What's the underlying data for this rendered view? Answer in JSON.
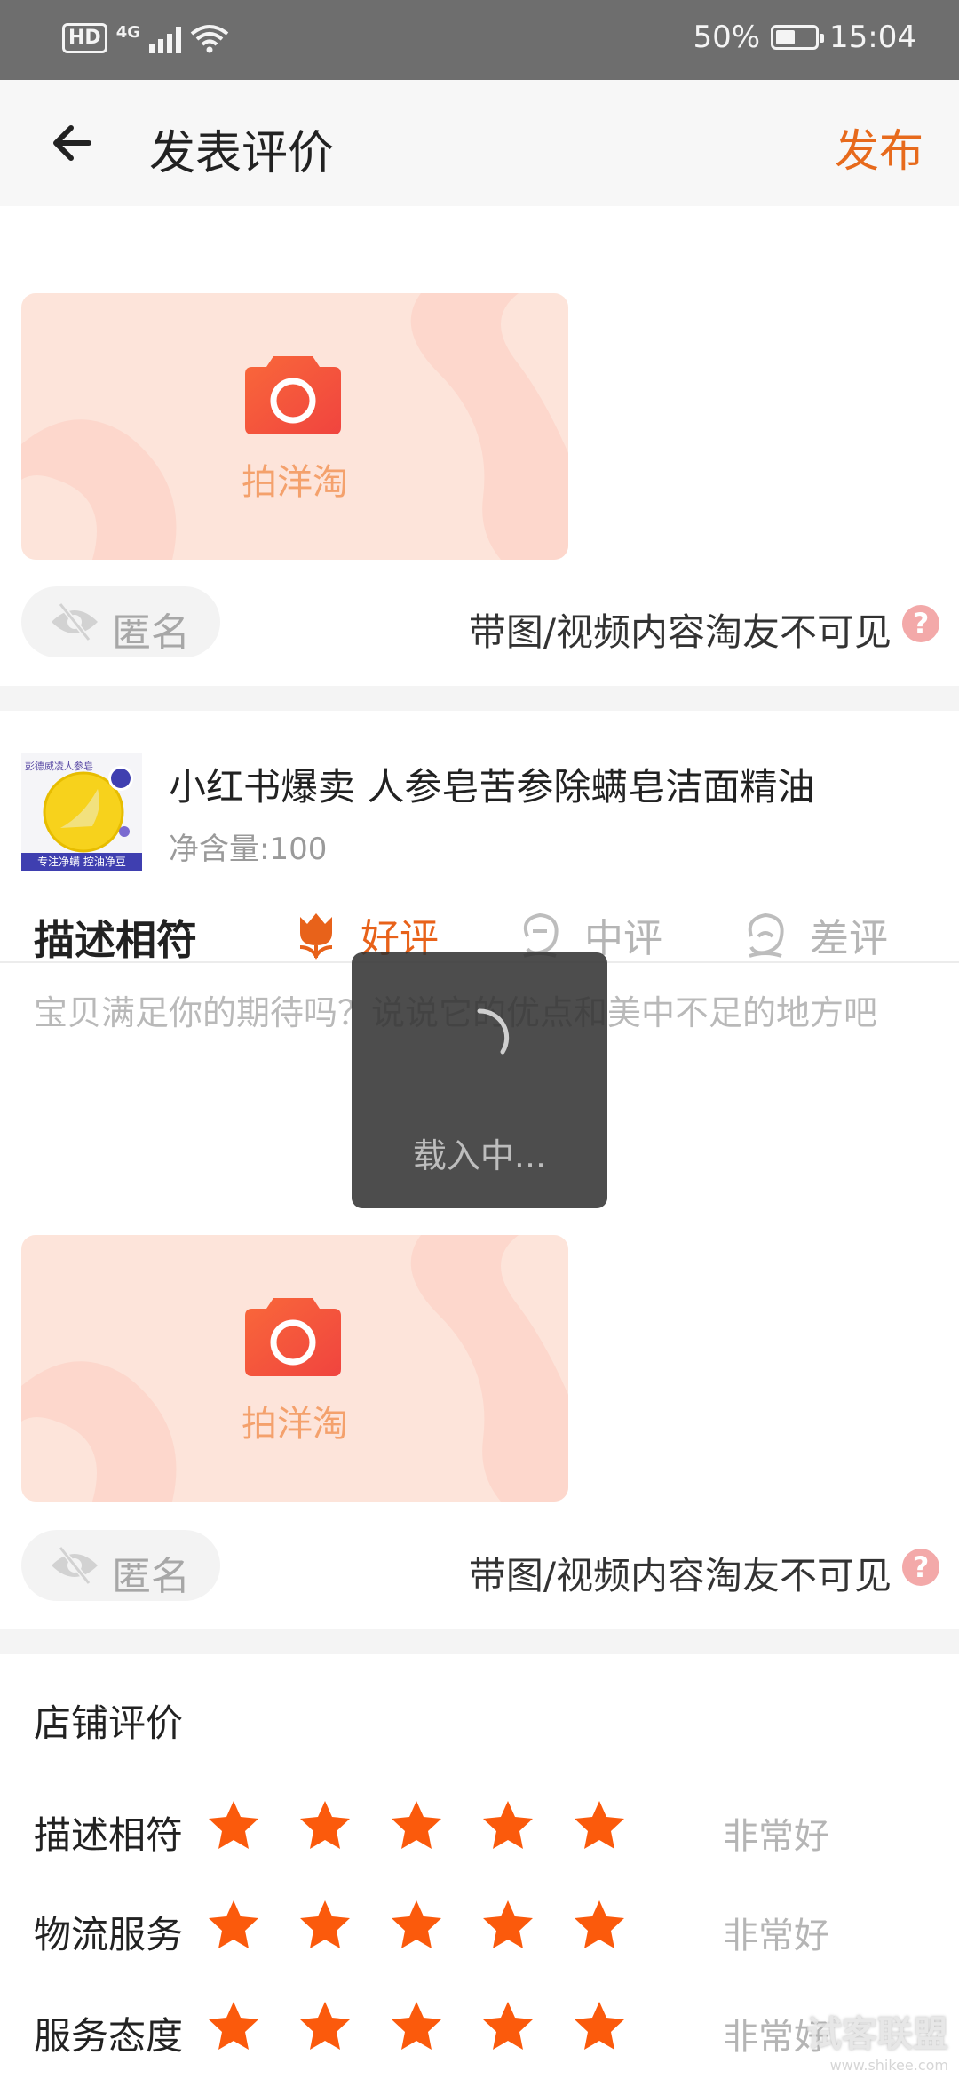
{
  "status_bar": {
    "hd": "HD",
    "network": "4G",
    "battery_percent": "50%",
    "battery_level": 0.5,
    "time": "15:04"
  },
  "header": {
    "back_icon": "arrow-left-icon",
    "title": "发表评价",
    "publish_label": "发布"
  },
  "upload_sections": [
    {
      "camera_icon": "camera-icon",
      "upload_label": "拍洋淘",
      "anonymous_label": "匿名",
      "hint": "带图/视频内容淘友不可见",
      "help_icon": "?"
    },
    {
      "camera_icon": "camera-icon",
      "upload_label": "拍洋淘",
      "anonymous_label": "匿名",
      "hint": "带图/视频内容淘友不可见",
      "help_icon": "?"
    }
  ],
  "product": {
    "thumb_top_text": "彭德威凌人参皂",
    "thumb_bottom_text": "专注净螨  控油净豆",
    "title": "小红书爆卖 人参皂苦参除螨皂洁面精油",
    "spec": "净含量:100"
  },
  "rating": {
    "label": "描述相符",
    "options": [
      {
        "label": "好评",
        "icon": "tulip-icon",
        "selected": true
      },
      {
        "label": "中评",
        "icon": "neutral-face-icon",
        "selected": false
      },
      {
        "label": "差评",
        "icon": "sad-face-icon",
        "selected": false
      }
    ]
  },
  "review": {
    "placeholder": "宝贝满足你的期待吗？说说它的优点和美中不足的地方吧"
  },
  "loading": {
    "text": "载入中..."
  },
  "shop_rating": {
    "title": "店铺评价",
    "rows": [
      {
        "label": "描述相符",
        "stars": 5,
        "description": "非常好"
      },
      {
        "label": "物流服务",
        "stars": 5,
        "description": "非常好"
      },
      {
        "label": "服务态度",
        "stars": 5,
        "description": "非常好"
      }
    ]
  },
  "watermark": {
    "title": "试客联盟",
    "url": "www.shikee.com"
  },
  "colors": {
    "accent": "#e76a1c",
    "star": "#fb5a0c",
    "upload_bg": "#fde4da",
    "camera": "#f2553d"
  }
}
